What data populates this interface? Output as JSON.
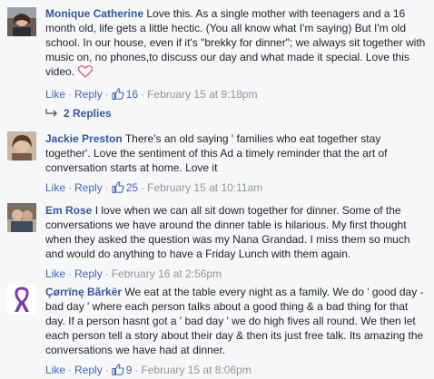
{
  "comments": [
    {
      "author": "Monique Catherine",
      "text": "Love this. As a single mother with teenagers and a 16 month old, life gets a little hectic. (You all know what I'm saying) But I'm old school. In our house, even if it's \"brekky for dinner\"; we always sit together with music on, no phones,to discuss our day and what made it special. Love this video.",
      "like_label": "Like",
      "reply_label": "Reply",
      "like_count": "16",
      "timestamp": "February 15 at 9:18pm",
      "replies_label": "2 Replies"
    },
    {
      "author": "Jackie Preston",
      "text": "There's an old saying ' families who eat together stay together'. Love the sentiment of this Ad a timely reminder that the art of conversation starts at home. Love it",
      "like_label": "Like",
      "reply_label": "Reply",
      "like_count": "25",
      "timestamp": "February 15 at 10:11am"
    },
    {
      "author": "Em Rose",
      "text": "I love when we can all sit down together for dinner. Some of the conversations we have around the dinner table is hilarious. My first thought when they asked the question was my Nana Grandad. I miss them so much and would do anything to have a Friday Lunch with them again.",
      "like_label": "Like",
      "reply_label": "Reply",
      "timestamp": "February 16 at 2:56pm"
    },
    {
      "author": "Çørrïnę Bãrkër",
      "text": "We eat at the table every night as a family. We do ' good day - bad day ' where each person talks about a good thing & a bad thing for that day. If a person hasnt got a ' bad day ' we do high fives all round. We then let each person tell a story about their day & then its just free talk. Its amazing the conversations we have had at dinner.",
      "like_label": "Like",
      "reply_label": "Reply",
      "like_count": "9",
      "timestamp": "February 15 at 8:06pm"
    }
  ],
  "icons": {
    "like": "thumbs-up-icon",
    "reaction": "heart-icon",
    "replies": "reply-arrow-icon"
  },
  "colors": {
    "link": "#4267b2",
    "author": "#365899",
    "meta": "#90949c",
    "background": "#f6f7f9"
  }
}
